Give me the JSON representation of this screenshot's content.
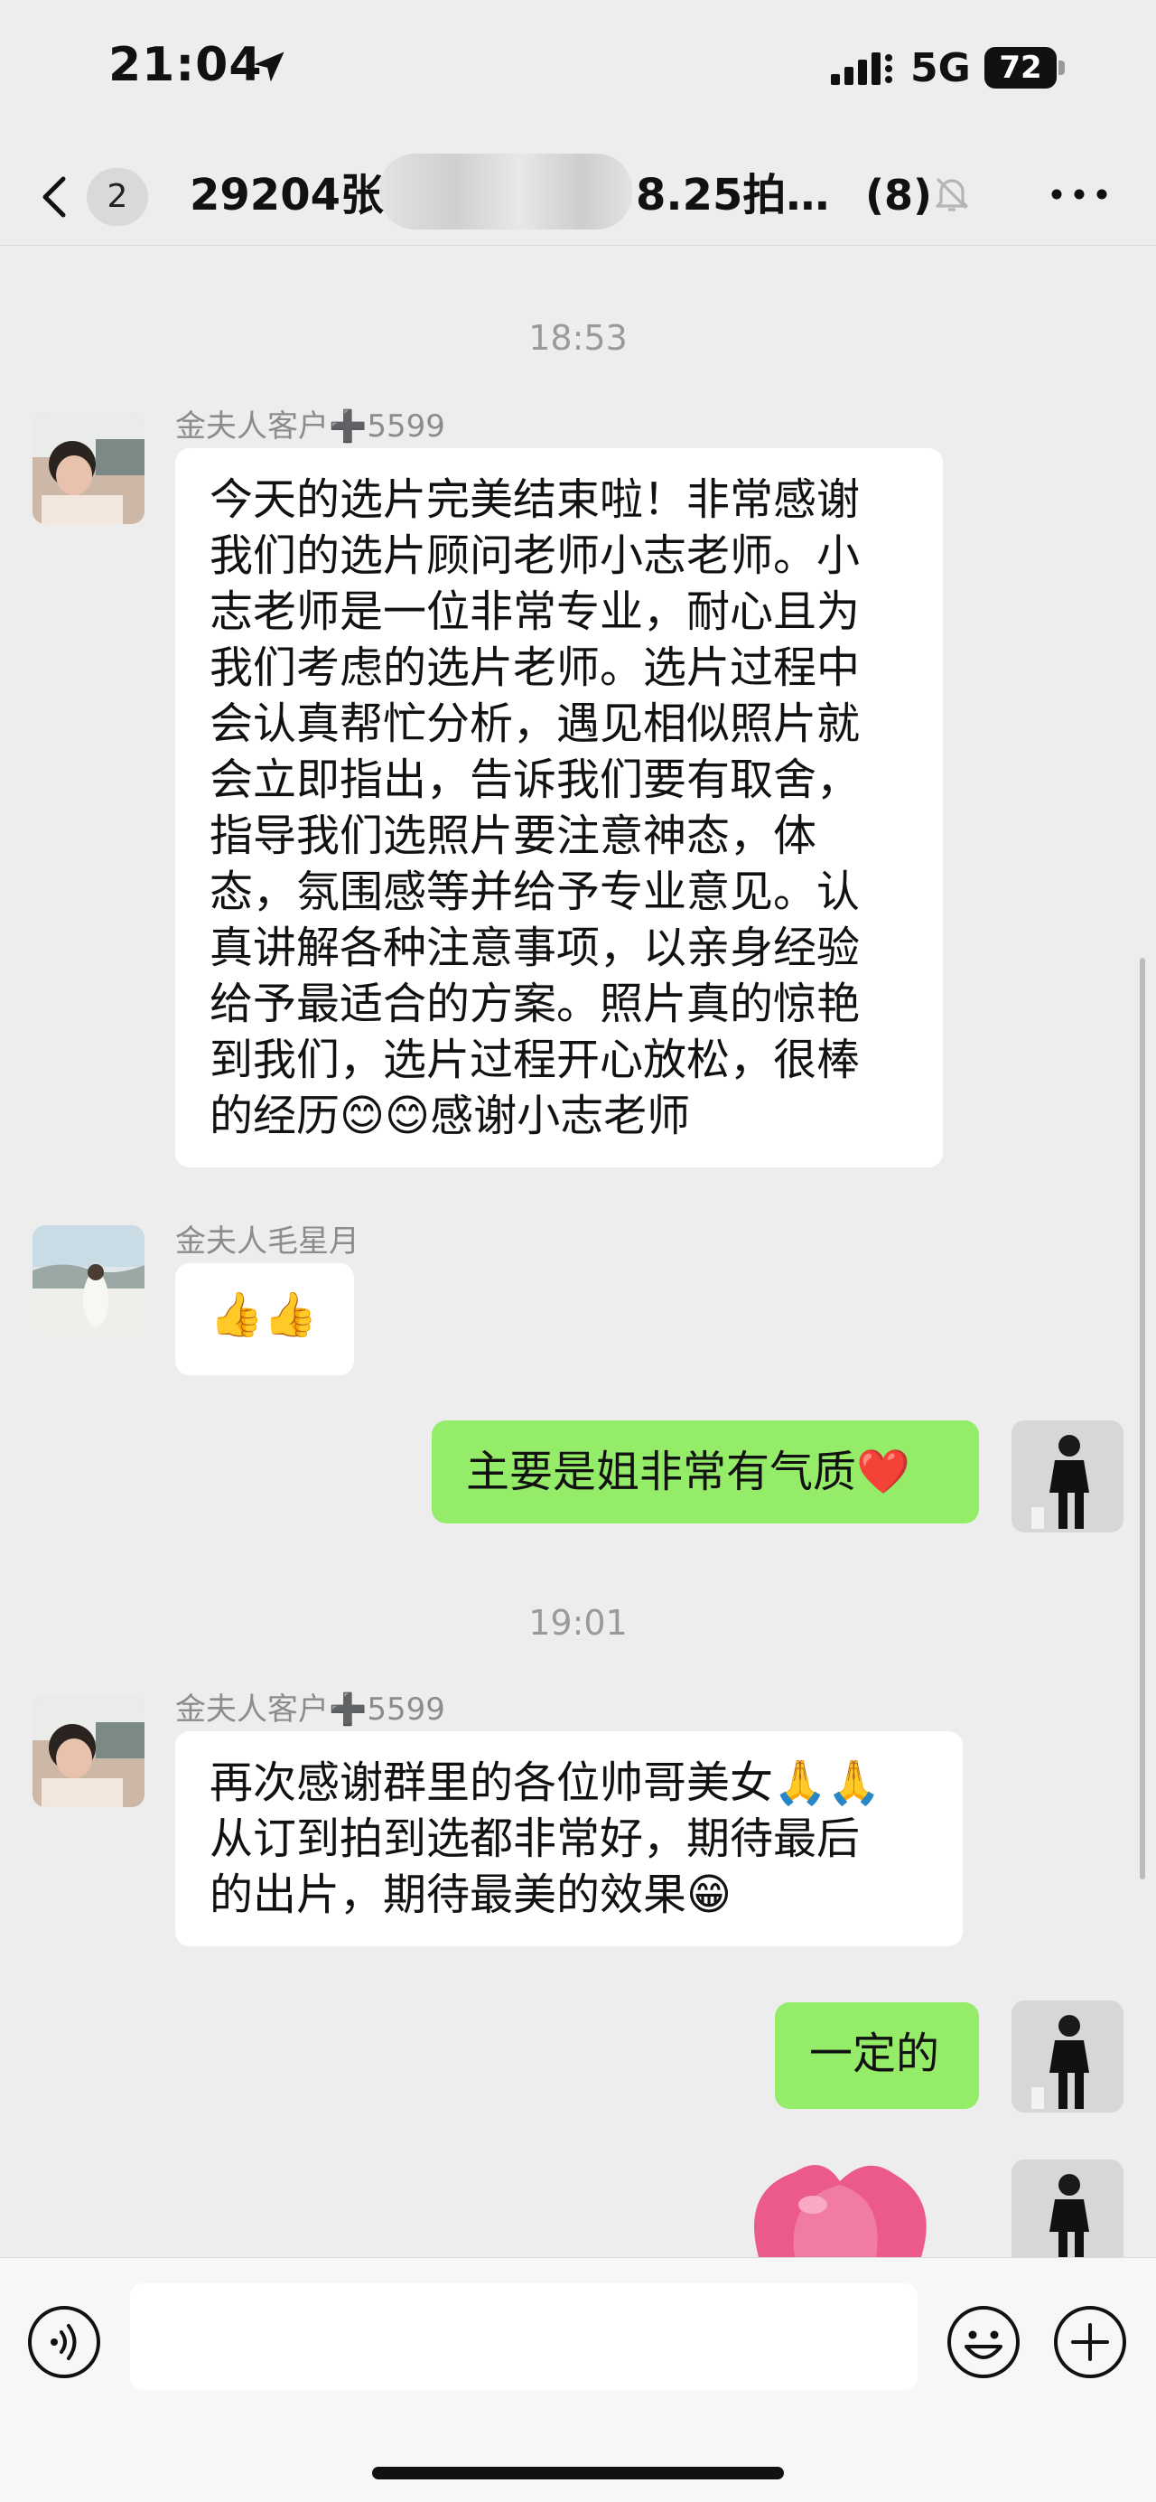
{
  "status_bar": {
    "time": "21:04",
    "network": "5G",
    "battery": "72"
  },
  "nav": {
    "unread_count": "2",
    "title_prefix": "29204张",
    "title_suffix": "8.25拍…",
    "member_count": "(8)"
  },
  "messages": {
    "time1": "18:53",
    "m1": {
      "sender": "金夫人客户➕5599",
      "text": "今天的选片完美结束啦！非常感谢\n我们的选片顾问老师小志老师。小\n志老师是一位非常专业，耐心且为\n我们考虑的选片老师。选片过程中\n会认真帮忙分析，遇见相似照片就\n会立即指出，告诉我们要有取舍，\n指导我们选照片要注意神态，体\n态，氛围感等并给予专业意见。认\n真讲解各种注意事项，以亲身经验\n给予最适合的方案。照片真的惊艳\n到我们，选片过程开心放松，很棒\n的经历😊😊感谢小志老师"
    },
    "m2": {
      "sender": "金夫人毛星月",
      "text": "👍👍"
    },
    "m3": {
      "text": "主要是姐非常有气质❤️"
    },
    "time2": "19:01",
    "m4": {
      "sender": "金夫人客户➕5599",
      "text": "再次感谢群里的各位帅哥美女🙏🙏\n从订到拍到选都非常好，期待最后\n的出片，期待最美的效果😁"
    },
    "m5": {
      "text": "一定的"
    }
  },
  "icons": {
    "location": "location-arrow-icon",
    "signal": "signal-icon",
    "back": "chevron-left-icon",
    "mute": "bell-off-icon",
    "more": "more-dots-icon",
    "voice": "voice-icon",
    "emoji": "smiley-icon",
    "plus": "plus-circle-icon"
  },
  "colors": {
    "background": "#ededed",
    "outgoing_bubble": "#95ec69",
    "incoming_bubble": "#ffffff"
  }
}
